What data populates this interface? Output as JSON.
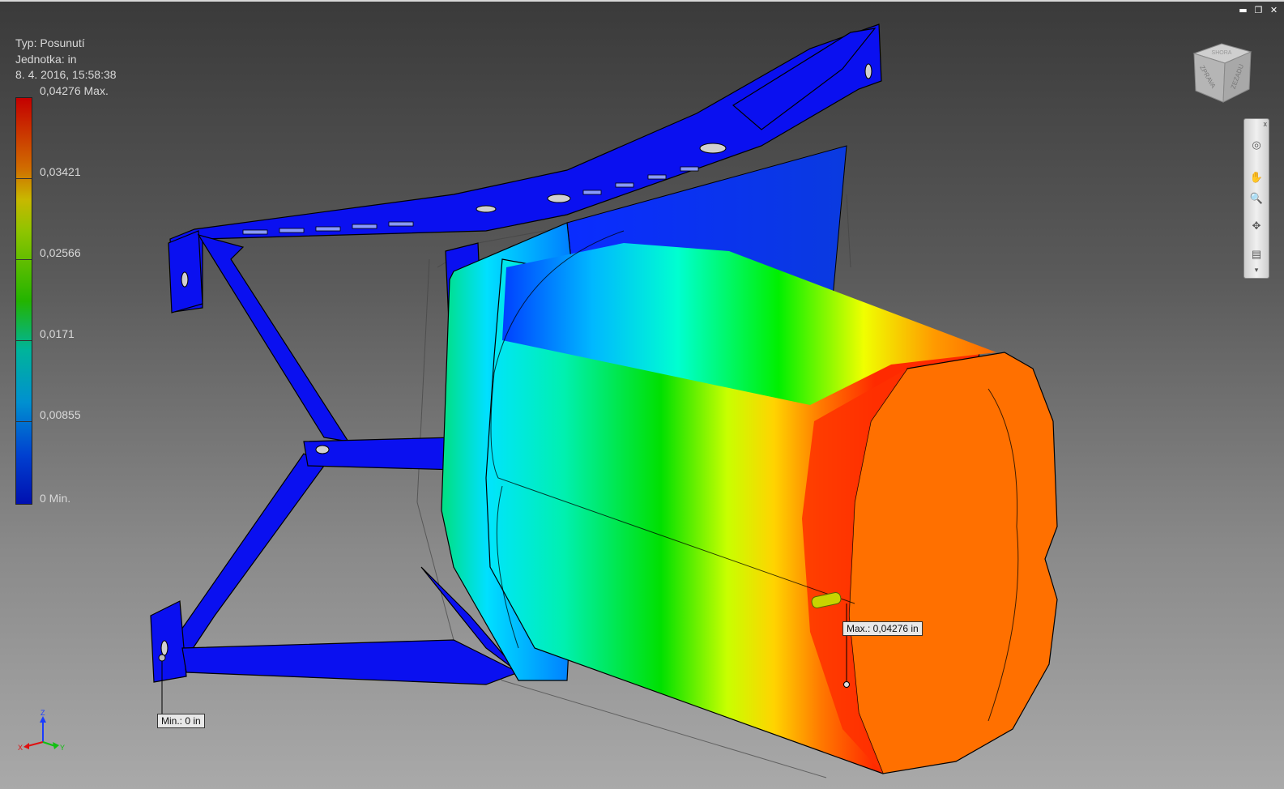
{
  "window": {
    "minimize": "▬",
    "restore": "❐",
    "close": "✕"
  },
  "legend": {
    "type": "Typ: Posunutí",
    "unit": "Jednotka: in",
    "date": "8. 4. 2016, 15:58:38",
    "labels": [
      "0,04276 Max.",
      "0,03421",
      "0,02566",
      "0,0171",
      "0,00855",
      "0 Min."
    ]
  },
  "callouts": {
    "max": "Max.: 0,04276 in",
    "min": "Min.: 0 in"
  },
  "viewcube": {
    "face_left": "ZPRAVA",
    "face_right": "ZEZADU",
    "face_top": "SHORA"
  },
  "navbar": {
    "close": "x",
    "wheel": "◎",
    "pan": "✋",
    "zoom": "🔍",
    "orbit": "✥",
    "look": "▤",
    "more": "▾"
  },
  "triad": {
    "x": "X",
    "y": "Y",
    "z": "Z"
  },
  "colors": {
    "max": "#ff3000",
    "min": "#0012ff",
    "background_top": "#3a3a3a",
    "background_bottom": "#a9a9a9"
  }
}
